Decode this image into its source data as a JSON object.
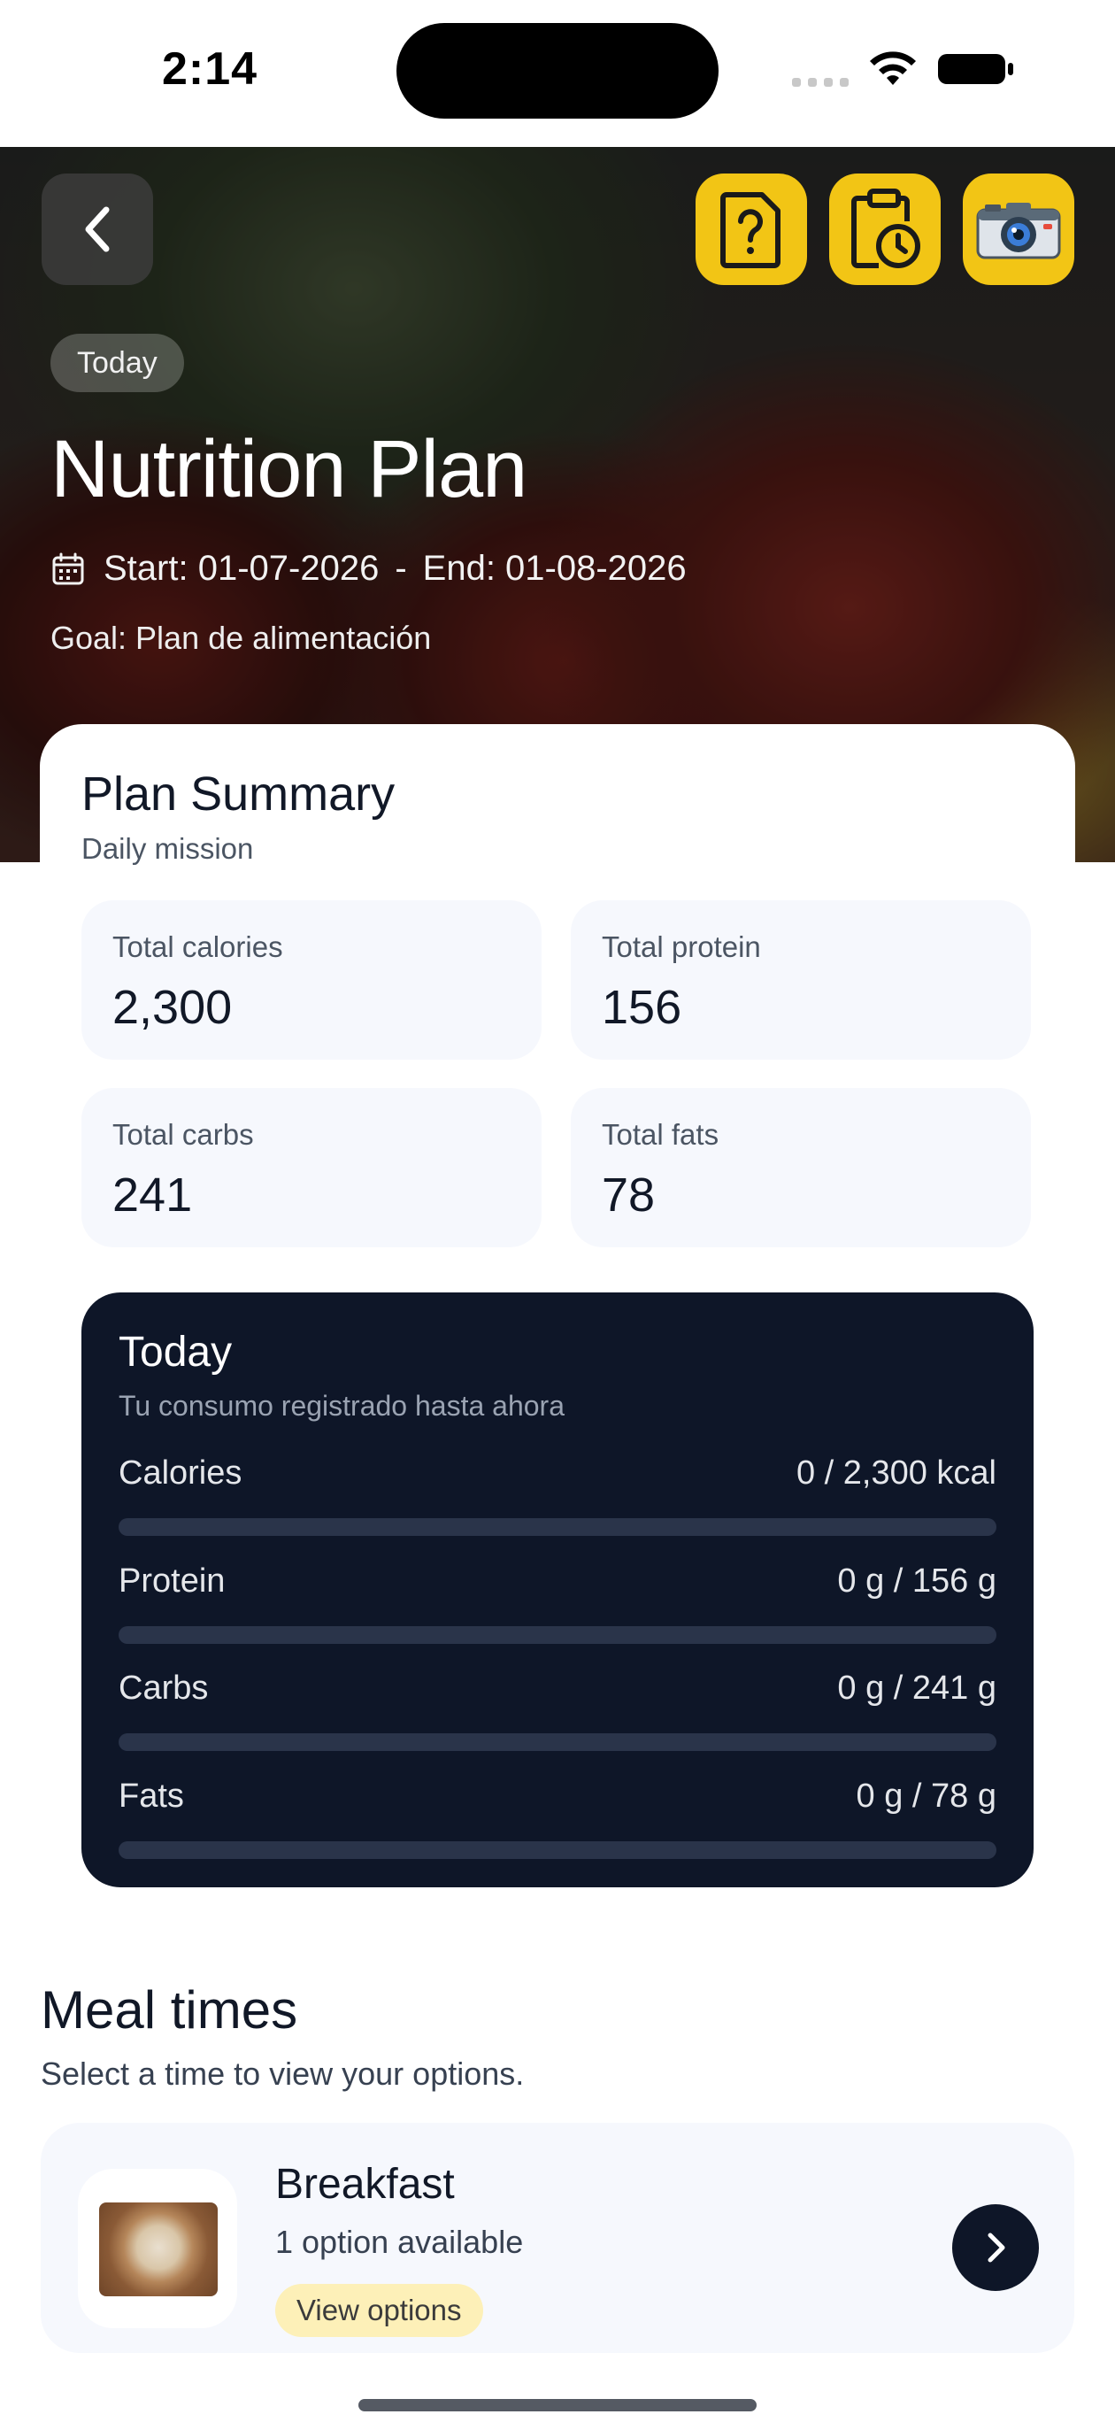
{
  "status_bar": {
    "time": "2:14"
  },
  "hero": {
    "badge": "Today",
    "title": "Nutrition Plan",
    "start": "Start: 01-07-2026",
    "separator": "-",
    "end": "End: 01-08-2026",
    "goal": "Goal: Plan de alimentación"
  },
  "actions": {
    "back_icon": "chevron-left-icon",
    "help_icon": "question-document-icon",
    "history_icon": "clipboard-clock-icon",
    "camera_icon": "camera-icon",
    "accent_color": "#f2c515"
  },
  "summary": {
    "title": "Plan Summary",
    "subtitle": "Daily mission",
    "stats": [
      {
        "label": "Total calories",
        "value": "2,300"
      },
      {
        "label": "Total protein",
        "value": "156"
      },
      {
        "label": "Total carbs",
        "value": "241"
      },
      {
        "label": "Total fats",
        "value": "78"
      }
    ]
  },
  "today": {
    "title": "Today",
    "subtitle": "Tu consumo registrado hasta ahora",
    "macros": [
      {
        "name": "Calories",
        "amount": "0 / 2,300 kcal",
        "progress": 0
      },
      {
        "name": "Protein",
        "amount": "0 g / 156 g",
        "progress": 0
      },
      {
        "name": "Carbs",
        "amount": "0 g / 241 g",
        "progress": 0
      },
      {
        "name": "Fats",
        "amount": "0 g / 78 g",
        "progress": 0
      }
    ]
  },
  "meals": {
    "title": "Meal times",
    "subtitle": "Select a time to view your options.",
    "items": [
      {
        "name": "Breakfast",
        "count": "1 option available",
        "action": "View options"
      }
    ]
  }
}
